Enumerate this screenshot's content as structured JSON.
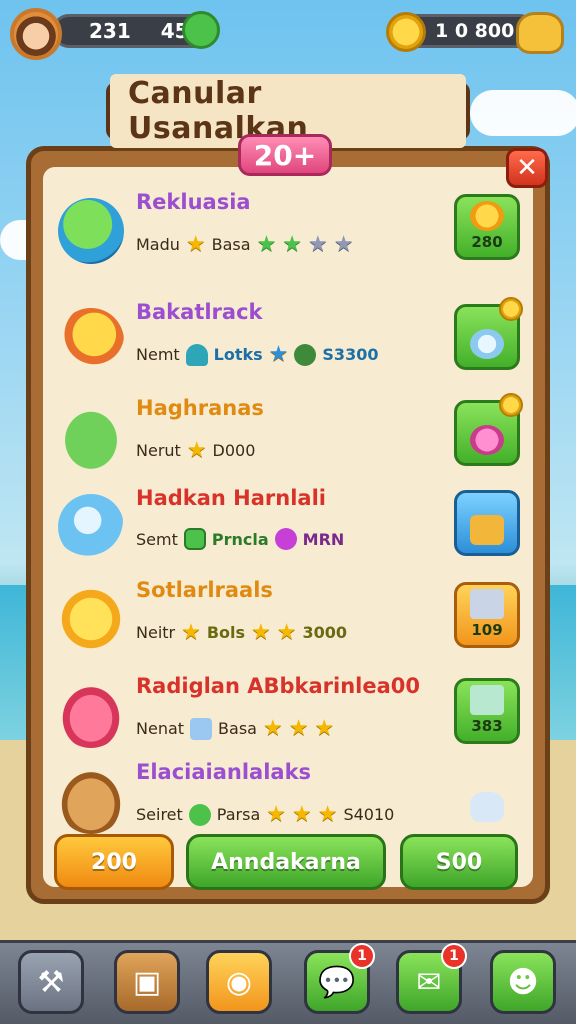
{
  "hud": {
    "left_value_1": "231",
    "left_value_2": "45",
    "coins": "1 0 800"
  },
  "title": "Canular Usanalkan",
  "level_badge": "20+",
  "close_label": "✕",
  "items": [
    {
      "name": "Rekluasia",
      "name_color": "#9b4fd0",
      "detail_label": "Madu",
      "detail_text": "Basa",
      "action_value": "280",
      "action_color": "green"
    },
    {
      "name": "Bakatlrack",
      "name_color": "#9b4fd0",
      "detail_label": "Nemt",
      "detail_text": "Lotks",
      "detail_value": "S3300",
      "action_value": "",
      "action_color": "green",
      "has_coin_badge": true
    },
    {
      "name": "Haghranas",
      "name_color": "#e08a12",
      "detail_label": "Nerut",
      "detail_value": "D000",
      "action_value": "",
      "action_color": "green",
      "has_coin_badge": true
    },
    {
      "name": "Hadkan Harnlali",
      "name_color": "#d8332a",
      "detail_label": "Semt",
      "detail_text": "Prncla",
      "detail_value": "MRN",
      "action_value": "",
      "action_color": "blue"
    },
    {
      "name": "Sotlarlraals",
      "name_color": "#e08a12",
      "detail_label": "Neitr",
      "detail_text": "Bols",
      "detail_value": "3000",
      "action_value": "109",
      "action_color": "orange"
    },
    {
      "name": "Radiglan ABbkarinlea00",
      "name_color": "#d8332a",
      "detail_label": "Nenat",
      "detail_text": "Basa",
      "action_value": "383",
      "action_color": "green"
    },
    {
      "name": "Elaciaianlalaks",
      "name_color": "#9b4fd0",
      "detail_label": "Seiret",
      "detail_text": "Parsa",
      "detail_value": "S4010",
      "action_value": "",
      "action_color": "none"
    }
  ],
  "footer": {
    "left_button": "200",
    "center_button": "Anndakarna",
    "right_button": "S00"
  },
  "toolbar": {
    "notif_1": "1",
    "notif_2": "1"
  }
}
